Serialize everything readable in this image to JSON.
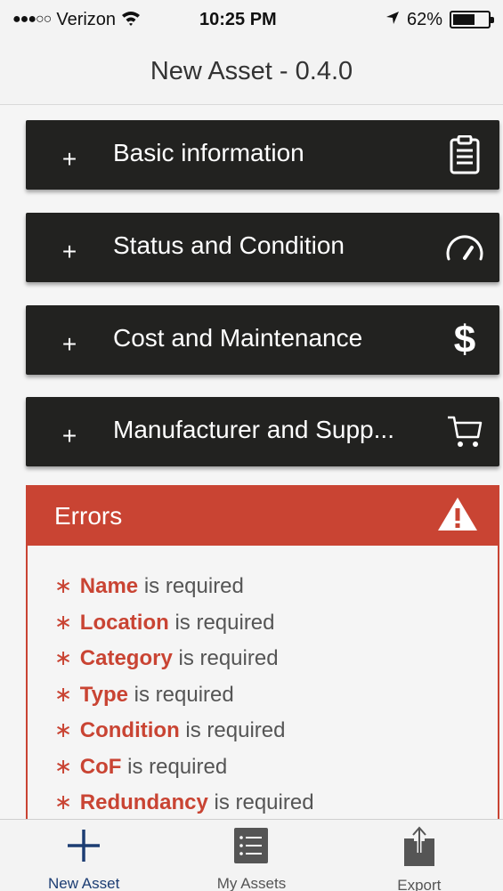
{
  "status_bar": {
    "signal": "●●●○○",
    "carrier": "Verizon",
    "time": "10:25 PM",
    "battery": "62%",
    "battery_level": 0.62
  },
  "nav": {
    "title": "New Asset - 0.4.0"
  },
  "sections": [
    {
      "plus": "+",
      "title": "Basic information",
      "icon": "clipboard-icon"
    },
    {
      "plus": "+",
      "title": "Status and Condition",
      "icon": "speedometer-icon"
    },
    {
      "plus": "+",
      "title": "Cost and Maintenance",
      "icon": "dollar-icon"
    },
    {
      "plus": "+",
      "title": "Manufacturer and Supp...",
      "icon": "cart-icon"
    }
  ],
  "errors": {
    "title": "Errors",
    "icon": "warning-icon",
    "items": [
      {
        "field": "Name",
        "text": " is required"
      },
      {
        "field": "Location",
        "text": " is required"
      },
      {
        "field": "Category",
        "text": " is required"
      },
      {
        "field": "Type",
        "text": " is required"
      },
      {
        "field": "Condition",
        "text": " is required"
      },
      {
        "field": "CoF",
        "text": " is required"
      },
      {
        "field": "Redundancy",
        "text": " is required"
      }
    ]
  },
  "tabs": [
    {
      "label": "New Asset",
      "icon": "plus-icon",
      "active": true
    },
    {
      "label": "My Assets",
      "icon": "list-icon",
      "active": false
    },
    {
      "label": "Export",
      "icon": "share-icon",
      "active": false
    }
  ],
  "colors": {
    "error_red": "#c94433",
    "section_bg": "#222220",
    "active_tab": "#1c3d73"
  }
}
